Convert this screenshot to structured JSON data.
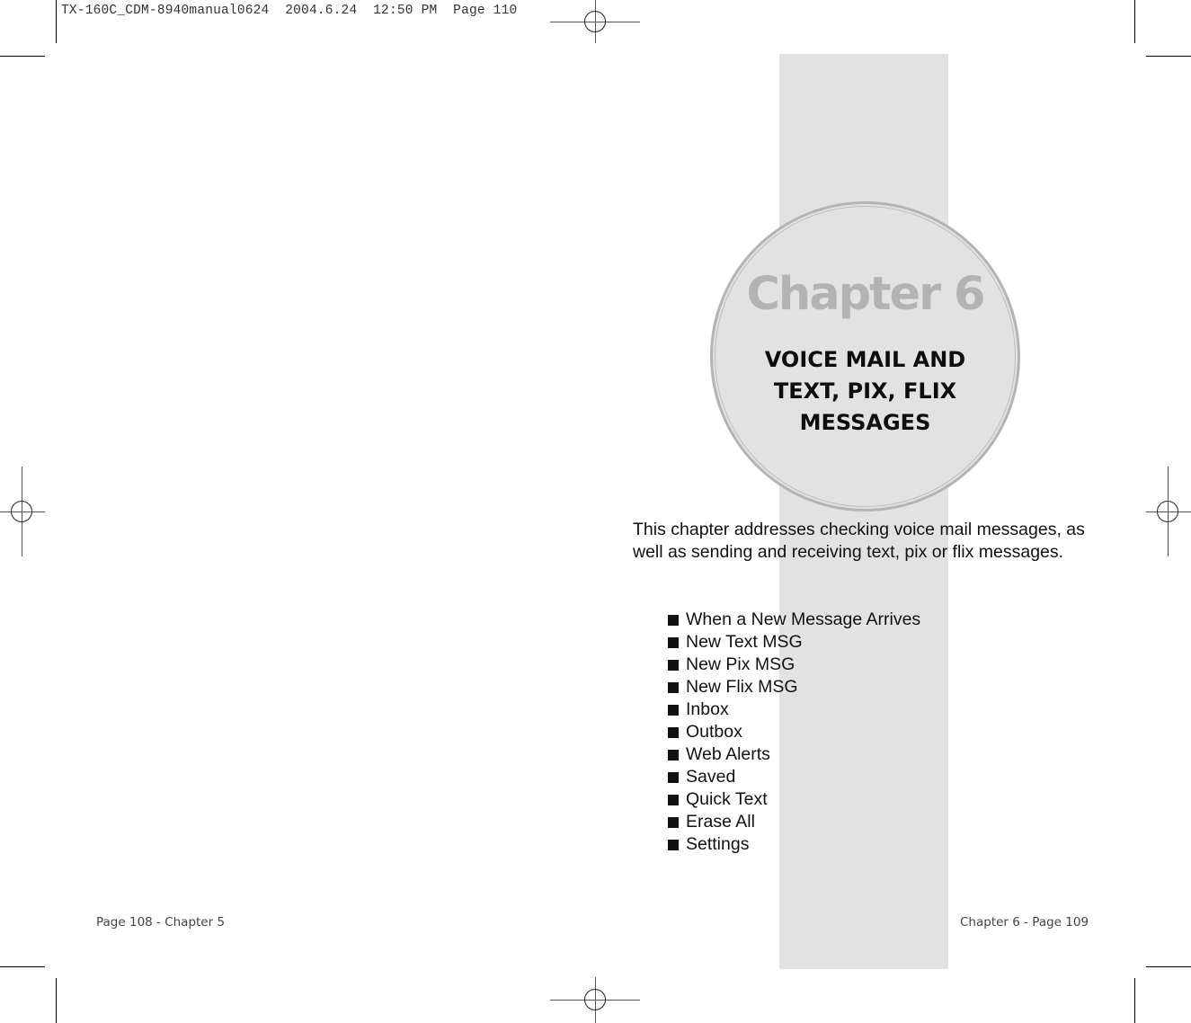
{
  "slug": {
    "text": "TX-160C_CDM-8940manual0624  2004.6.24  12:50 PM  Page 110"
  },
  "chapter": {
    "number_label": "Chapter 6",
    "title_lines": [
      "VOICE MAIL AND",
      "TEXT, PIX, FLIX",
      "MESSAGES"
    ]
  },
  "intro": {
    "text": "This chapter addresses checking voice mail messages, as well as sending and receiving text, pix or flix messages."
  },
  "topics": {
    "bullet_icon": "black-square-bullet",
    "items": [
      "When a New Message Arrives",
      "New Text MSG",
      "New Pix MSG",
      "New Flix MSG",
      "Inbox",
      "Outbox",
      "Web Alerts",
      "Saved",
      "Quick Text",
      "Erase All",
      "Settings"
    ]
  },
  "footer": {
    "left": "Page 108 - Chapter 5",
    "right": "Chapter 6 - Page 109"
  },
  "colors": {
    "band": "#e2e2e2",
    "circle_ring": "#b4b4b4",
    "chapter_number": "#b3b3b3",
    "text": "#111111"
  },
  "icons": {
    "registration_mark": "crosshair-circle-icon",
    "crop_mark": "corner-crop-mark-icon"
  }
}
